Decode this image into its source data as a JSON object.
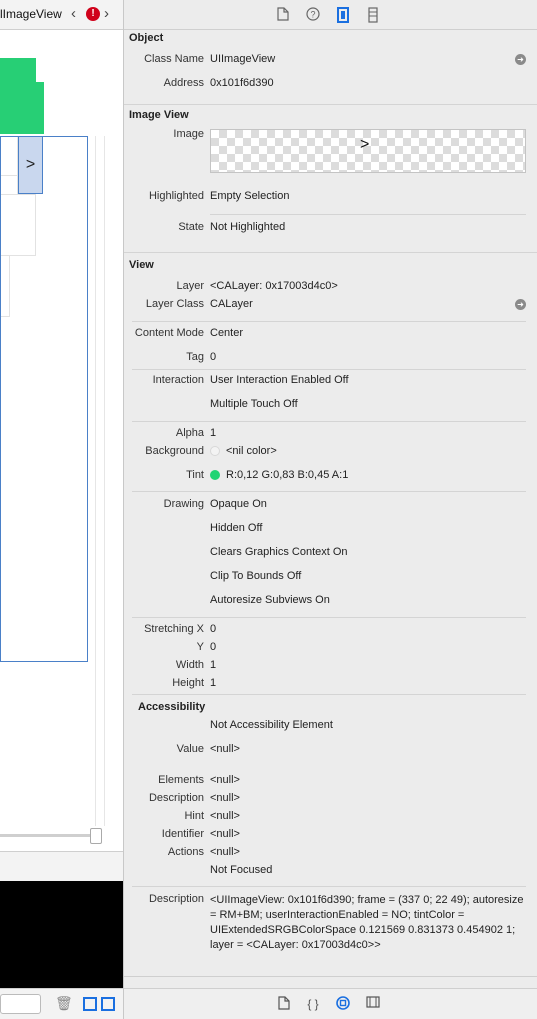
{
  "editor": {
    "title": "lImageView",
    "back_icon": "chevron-left-icon",
    "warning_icon": "error-icon",
    "warning_glyph": "!",
    "forward_icon": "chevron-right-icon",
    "selected_chevron": ">"
  },
  "toolbar_tabs": [
    "file-inspector-icon",
    "quick-help-icon",
    "identity-inspector-icon",
    "size-inspector-icon"
  ],
  "object": {
    "section": "Object",
    "class_name_label": "Class Name",
    "class_name": "UIImageView",
    "address_label": "Address",
    "address": "0x101f6d390"
  },
  "image_view": {
    "section": "Image View",
    "image_label": "Image",
    "highlighted_label": "Highlighted",
    "highlighted": "Empty Selection",
    "state_label": "State",
    "state": "Not Highlighted"
  },
  "view": {
    "section": "View",
    "layer_label": "Layer",
    "layer": "<CALayer: 0x17003d4c0>",
    "layer_class_label": "Layer Class",
    "layer_class": "CALayer",
    "content_mode_label": "Content Mode",
    "content_mode": "Center",
    "tag_label": "Tag",
    "tag": "0",
    "interaction_label": "Interaction",
    "interaction": "User Interaction Enabled Off",
    "multiple_touch": "Multiple Touch Off",
    "alpha_label": "Alpha",
    "alpha": "1",
    "background_label": "Background",
    "background": "<nil color>",
    "tint_label": "Tint",
    "tint": "R:0,12 G:0,83 B:0,45 A:1",
    "tint_color": "#1fd473",
    "drawing_label": "Drawing",
    "opaque": "Opaque On",
    "hidden": "Hidden Off",
    "clears": "Clears Graphics Context On",
    "clip": "Clip To Bounds Off",
    "autoresize": "Autoresize Subviews On",
    "stretching_x_label": "Stretching X",
    "stretching_x": "0",
    "y_label": "Y",
    "y": "0",
    "width_label": "Width",
    "width": "1",
    "height_label": "Height",
    "height": "1"
  },
  "accessibility": {
    "section": "Accessibility",
    "element": "Not Accessibility Element",
    "value_label": "Value",
    "value": "<null>",
    "elements_label": "Elements",
    "elements": "<null>",
    "description_label": "Description",
    "description": "<null>",
    "hint_label": "Hint",
    "hint": "<null>",
    "identifier_label": "Identifier",
    "identifier": "<null>",
    "actions_label": "Actions",
    "actions": "<null>",
    "focused": "Not Focused"
  },
  "description": {
    "label": "Description",
    "value": "<UIImageView: 0x101f6d390; frame = (337 0; 22 49); autoresize = RM+BM; userInteractionEnabled = NO; tintColor = UIExtendedSRGBColorSpace 0.121569 0.831373 0.454902 1; layer = <CALayer: 0x17003d4c0>>"
  },
  "bottom_tabs": [
    "file-template-icon",
    "code-snippet-icon",
    "object-library-icon",
    "media-library-icon"
  ],
  "bottom_tab_glyphs": {
    "code": "{ }"
  },
  "accent_color": "#1a6fe0"
}
